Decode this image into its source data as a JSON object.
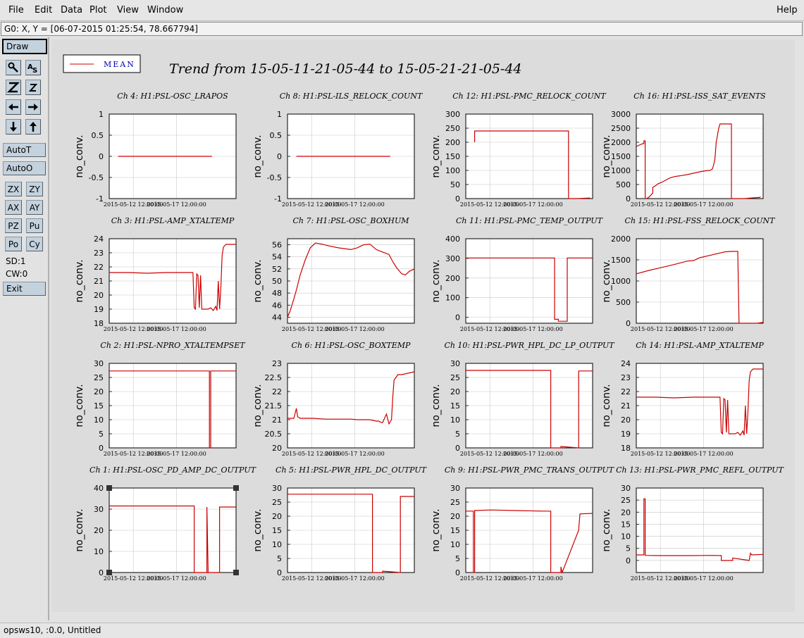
{
  "menu": {
    "file": "File",
    "edit": "Edit",
    "data": "Data",
    "plot": "Plot",
    "view": "View",
    "window": "Window",
    "help": "Help"
  },
  "coord_readout": "G0: X, Y = [06-07-2015 01:25:54, 78.667794]",
  "toolbar": {
    "draw": "Draw",
    "autot": "AutoT",
    "autoo": "AutoO",
    "zx": "ZX",
    "zy": "ZY",
    "ax": "AX",
    "ay": "AY",
    "pz": "PZ",
    "pu": "Pu",
    "po": "Po",
    "cy": "Cy",
    "sd": "SD:1",
    "cw": "CW:0",
    "exit": "Exit",
    "icons": [
      "magnify-icon",
      "text-icon",
      "zoom-z-large-icon",
      "zoom-z-small-icon",
      "arrow-left-icon",
      "arrow-right-icon",
      "arrow-down-icon",
      "arrow-up-icon"
    ]
  },
  "status": "opsws10, :0.0, Untitled",
  "legend_label": "MEAN",
  "main_title": "Trend from 15-05-11-21-05-44 to 15-05-21-21-05-44",
  "y_axis_label": "no_conv.",
  "x_tick_labels": [
    "2015-05-12 12:00:00",
    "2015-05-17 12:00:00"
  ],
  "colors": {
    "trace": "#cc0000",
    "legend_text": "#0000aa",
    "grid": "#c8c8c8"
  },
  "chart_data": [
    {
      "type": "line",
      "title": "Ch 4: H1:PSL-OSC_LRAPOS",
      "ylim": [
        -1,
        1
      ],
      "yticks": [
        -1,
        -0.5,
        0,
        0.5,
        1
      ],
      "series": [
        {
          "name": "MEAN",
          "x": [
            0.07,
            0.81
          ],
          "y": [
            0,
            0
          ]
        }
      ]
    },
    {
      "type": "line",
      "title": "Ch 8: H1:PSL-ILS_RELOCK_COUNT",
      "ylim": [
        -1,
        1
      ],
      "yticks": [
        -1,
        -0.5,
        0,
        0.5,
        1
      ],
      "series": [
        {
          "name": "MEAN",
          "x": [
            0.07,
            0.81
          ],
          "y": [
            0,
            0
          ]
        }
      ]
    },
    {
      "type": "line",
      "title": "Ch 12: H1:PSL-PMC_RELOCK_COUNT",
      "ylim": [
        0,
        300
      ],
      "yticks": [
        0,
        50,
        100,
        150,
        200,
        250,
        300
      ],
      "series": [
        {
          "name": "MEAN",
          "x": [
            0.07,
            0.07,
            0.08,
            0.08,
            0.81,
            0.81,
            0.87,
            0.98
          ],
          "y": [
            200,
            240,
            240,
            240,
            240,
            0,
            0,
            2
          ]
        }
      ]
    },
    {
      "type": "line",
      "title": "Ch 16: H1:PSL-ISS_SAT_EVENTS",
      "ylim": [
        0,
        3000
      ],
      "yticks": [
        0,
        500,
        1000,
        1500,
        2000,
        2500,
        3000
      ],
      "series": [
        {
          "name": "MEAN",
          "x": [
            0.0,
            0.05,
            0.06,
            0.06,
            0.07,
            0.07,
            0.08,
            0.1,
            0.13,
            0.13,
            0.15,
            0.17,
            0.19,
            0.21,
            0.23,
            0.25,
            0.27,
            0.3,
            0.33,
            0.36,
            0.4,
            0.45,
            0.5,
            0.55,
            0.58,
            0.6,
            0.61,
            0.62,
            0.63,
            0.65,
            0.66,
            0.7,
            0.75,
            0.75,
            0.85,
            0.9,
            0.97,
            0.98
          ],
          "y": [
            1850,
            1950,
            1950,
            2050,
            2050,
            0,
            0,
            50,
            200,
            400,
            450,
            520,
            560,
            600,
            650,
            700,
            740,
            780,
            800,
            820,
            850,
            900,
            950,
            990,
            1000,
            1050,
            1200,
            1400,
            2000,
            2500,
            2650,
            2650,
            2650,
            0,
            0,
            20,
            40,
            60
          ]
        }
      ]
    },
    {
      "type": "line",
      "title": "Ch 3: H1:PSL-AMP_XTALTEMP",
      "ylim": [
        18,
        24
      ],
      "yticks": [
        18,
        19,
        20,
        21,
        22,
        23,
        24
      ],
      "series": [
        {
          "name": "MEAN",
          "x": [
            0.0,
            0.15,
            0.3,
            0.45,
            0.6,
            0.66,
            0.67,
            0.68,
            0.69,
            0.7,
            0.71,
            0.72,
            0.73,
            0.75,
            0.78,
            0.8,
            0.82,
            0.84,
            0.85,
            0.86,
            0.87,
            0.88,
            0.89,
            0.9,
            0.92,
            0.95,
            1.0
          ],
          "y": [
            21.6,
            21.6,
            21.55,
            21.6,
            21.6,
            21.6,
            19.1,
            19.0,
            21.5,
            21.4,
            19.1,
            21.4,
            19.0,
            19.0,
            19.0,
            19.1,
            18.9,
            19.2,
            18.9,
            21.0,
            19.0,
            20.5,
            22.8,
            23.4,
            23.6,
            23.6,
            23.6
          ]
        }
      ]
    },
    {
      "type": "line",
      "title": "Ch 7: H1:PSL-OSC_BOXHUM",
      "ylim": [
        43,
        57
      ],
      "yticks": [
        44,
        46,
        48,
        50,
        52,
        54,
        56
      ],
      "series": [
        {
          "name": "MEAN",
          "x": [
            0.0,
            0.02,
            0.05,
            0.07,
            0.1,
            0.14,
            0.18,
            0.22,
            0.27,
            0.33,
            0.4,
            0.5,
            0.55,
            0.6,
            0.65,
            0.7,
            0.75,
            0.8,
            0.83,
            0.86,
            0.9,
            0.93,
            0.96,
            1.0
          ],
          "y": [
            44,
            45,
            47,
            48.5,
            51,
            53.5,
            55.5,
            56.3,
            56.1,
            55.8,
            55.5,
            55.2,
            55.5,
            56.0,
            56.1,
            55.2,
            54.8,
            54.4,
            53.2,
            52.2,
            51.2,
            51.0,
            51.6,
            52.0
          ]
        }
      ]
    },
    {
      "type": "line",
      "title": "Ch 11: H1:PSL-PMC_TEMP_OUTPUT",
      "ylim": [
        -30,
        400
      ],
      "yticks": [
        0,
        100,
        200,
        300,
        400
      ],
      "series": [
        {
          "name": "MEAN",
          "x": [
            0.0,
            0.7,
            0.7,
            0.73,
            0.73,
            0.75,
            0.8,
            0.8,
            1.0
          ],
          "y": [
            302,
            302,
            -10,
            -10,
            -20,
            -20,
            -20,
            302,
            302
          ]
        }
      ]
    },
    {
      "type": "line",
      "title": "Ch 15: H1:PSL-FSS_RELOCK_COUNT",
      "ylim": [
        0,
        2000
      ],
      "yticks": [
        0,
        500,
        1000,
        1500,
        2000
      ],
      "series": [
        {
          "name": "MEAN",
          "x": [
            0.0,
            0.1,
            0.2,
            0.3,
            0.4,
            0.45,
            0.5,
            0.6,
            0.7,
            0.75,
            0.8,
            0.81,
            0.95,
            1.0
          ],
          "y": [
            1170,
            1250,
            1320,
            1390,
            1470,
            1480,
            1550,
            1620,
            1690,
            1700,
            1700,
            0,
            0,
            20
          ]
        }
      ]
    },
    {
      "type": "line",
      "title": "Ch 2: H1:PSL-NPRO_XTALTEMPSET",
      "ylim": [
        0,
        30
      ],
      "yticks": [
        0,
        5,
        10,
        15,
        20,
        25,
        30
      ],
      "series": [
        {
          "name": "MEAN",
          "x": [
            0.0,
            0.79,
            0.79,
            0.8,
            0.8,
            1.0
          ],
          "y": [
            27.3,
            27.3,
            0,
            0,
            27.3,
            27.3
          ]
        }
      ]
    },
    {
      "type": "line",
      "title": "Ch 6: H1:PSL-OSC_BOXTEMP",
      "ylim": [
        20,
        23
      ],
      "yticks": [
        20,
        20.5,
        21,
        21.5,
        22,
        22.5,
        23
      ],
      "series": [
        {
          "name": "MEAN",
          "x": [
            0.0,
            0.05,
            0.07,
            0.08,
            0.1,
            0.2,
            0.3,
            0.4,
            0.5,
            0.55,
            0.6,
            0.65,
            0.7,
            0.72,
            0.74,
            0.75,
            0.78,
            0.8,
            0.82,
            0.83,
            0.84,
            0.87,
            0.9,
            0.95,
            1.0
          ],
          "y": [
            21.05,
            21.05,
            21.4,
            21.1,
            21.05,
            21.05,
            21.02,
            21.02,
            21.02,
            21.0,
            21.0,
            21.0,
            20.95,
            20.95,
            20.9,
            20.9,
            21.2,
            20.85,
            21.0,
            21.8,
            22.4,
            22.6,
            22.6,
            22.65,
            22.7
          ]
        }
      ]
    },
    {
      "type": "line",
      "title": "Ch 10: H1:PSL-PWR_HPL_DC_LP_OUTPUT",
      "ylim": [
        0,
        30
      ],
      "yticks": [
        0,
        5,
        10,
        15,
        20,
        25,
        30
      ],
      "series": [
        {
          "name": "MEAN",
          "x": [
            0.0,
            0.67,
            0.67,
            0.75,
            0.75,
            0.89,
            0.89,
            1.0
          ],
          "y": [
            27.5,
            27.5,
            0,
            0,
            0.5,
            0,
            27.3,
            27.3
          ]
        }
      ]
    },
    {
      "type": "line",
      "title": "Ch 14: H1:PSL-AMP_XTALTEMP",
      "ylim": [
        18,
        24
      ],
      "yticks": [
        18,
        19,
        20,
        21,
        22,
        23,
        24
      ],
      "series": [
        {
          "name": "MEAN",
          "x": [
            0.0,
            0.15,
            0.3,
            0.45,
            0.6,
            0.66,
            0.67,
            0.68,
            0.69,
            0.7,
            0.71,
            0.72,
            0.73,
            0.75,
            0.78,
            0.8,
            0.82,
            0.84,
            0.85,
            0.86,
            0.87,
            0.88,
            0.89,
            0.9,
            0.92,
            0.95,
            1.0
          ],
          "y": [
            21.6,
            21.6,
            21.55,
            21.6,
            21.6,
            21.6,
            19.1,
            19.0,
            21.5,
            21.4,
            19.1,
            21.4,
            19.0,
            19.0,
            19.0,
            19.1,
            18.9,
            19.2,
            18.9,
            21.0,
            19.0,
            20.5,
            22.8,
            23.4,
            23.6,
            23.6,
            23.6
          ]
        }
      ]
    },
    {
      "type": "line",
      "title": "Ch 1: H1:PSL-OSC_PD_AMP_DC_OUTPUT",
      "ylim": [
        0,
        40
      ],
      "yticks": [
        0,
        10,
        20,
        30,
        40
      ],
      "series": [
        {
          "name": "MEAN",
          "x": [
            0.0,
            0.67,
            0.67,
            0.77,
            0.77,
            0.78,
            0.78,
            0.87,
            0.87,
            1.0
          ],
          "y": [
            31.5,
            31.5,
            0,
            0,
            31,
            0,
            0,
            0,
            31,
            31
          ]
        }
      ]
    },
    {
      "type": "line",
      "title": "Ch 5: H1:PSL-PWR_HPL_DC_OUTPUT",
      "ylim": [
        0,
        30
      ],
      "yticks": [
        0,
        5,
        10,
        15,
        20,
        25,
        30
      ],
      "series": [
        {
          "name": "MEAN",
          "x": [
            0.0,
            0.67,
            0.67,
            0.75,
            0.75,
            0.89,
            0.89,
            1.0
          ],
          "y": [
            27.8,
            27.8,
            0,
            0,
            0.5,
            0,
            27.0,
            27.0
          ]
        }
      ]
    },
    {
      "type": "line",
      "title": "Ch 9: H1:PSL-PWR_PMC_TRANS_OUTPUT",
      "ylim": [
        0,
        30
      ],
      "yticks": [
        0,
        5,
        10,
        15,
        20,
        25,
        30
      ],
      "series": [
        {
          "name": "MEAN",
          "x": [
            0.0,
            0.06,
            0.06,
            0.07,
            0.07,
            0.2,
            0.4,
            0.6,
            0.67,
            0.67,
            0.75,
            0.75,
            0.76,
            0.89,
            0.9,
            1.0
          ],
          "y": [
            21.8,
            21.8,
            0,
            0,
            22,
            22.2,
            22,
            21.8,
            21.8,
            0,
            0,
            2,
            0,
            15,
            20.8,
            21
          ]
        }
      ]
    },
    {
      "type": "line",
      "title": "Ch 13: H1:PSL-PWR_PMC_REFL_OUTPUT",
      "ylim": [
        -5,
        30
      ],
      "yticks": [
        0,
        5,
        10,
        15,
        20,
        25,
        30
      ],
      "series": [
        {
          "name": "MEAN",
          "x": [
            0.0,
            0.06,
            0.06,
            0.07,
            0.07,
            0.2,
            0.4,
            0.6,
            0.67,
            0.67,
            0.76,
            0.76,
            0.89,
            0.9,
            0.91,
            1.0
          ],
          "y": [
            2.3,
            2.3,
            25.5,
            25.5,
            2.1,
            2.0,
            2.0,
            2.1,
            2.0,
            0,
            0,
            1,
            0,
            3,
            2.3,
            2.5
          ]
        }
      ]
    }
  ]
}
